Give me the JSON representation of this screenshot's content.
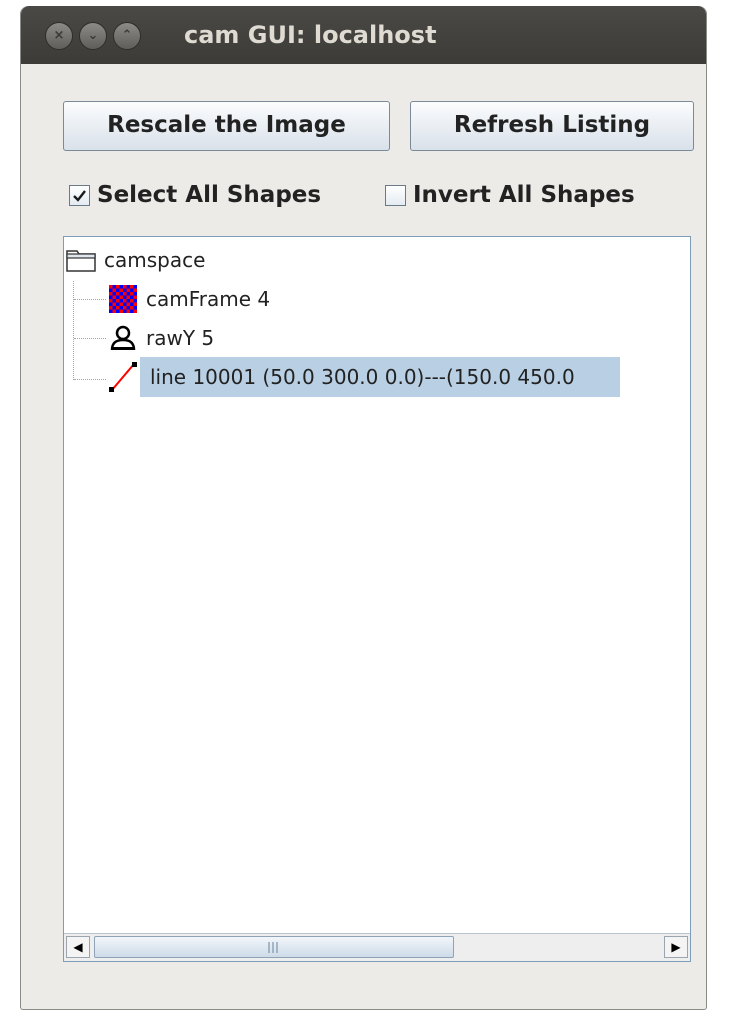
{
  "window": {
    "title": "cam GUI: localhost",
    "buttons": [
      "close-icon",
      "minimize-icon",
      "maximize-icon"
    ]
  },
  "toolbar": {
    "rescale_label": "Rescale the Image",
    "refresh_label": "Refresh Listing"
  },
  "options": {
    "select_all": {
      "label": "Select All Shapes",
      "checked": true
    },
    "invert_all": {
      "label": "Invert All Shapes",
      "checked": false
    }
  },
  "tree": {
    "root": {
      "label": "camspace",
      "icon": "folder-icon"
    },
    "children": [
      {
        "label": "camFrame 4",
        "icon": "checker-image-icon",
        "selected": false
      },
      {
        "label": "rawY 5",
        "icon": "person-icon",
        "selected": false
      },
      {
        "label": "line 10001 (50.0 300.0 0.0)---(150.0 450.0",
        "icon": "line-shape-icon",
        "selected": true
      }
    ]
  },
  "colors": {
    "selection": "#b9cfe4",
    "checker_a": "#ff0000",
    "checker_b": "#0000ff",
    "line_red": "#ff0000"
  }
}
